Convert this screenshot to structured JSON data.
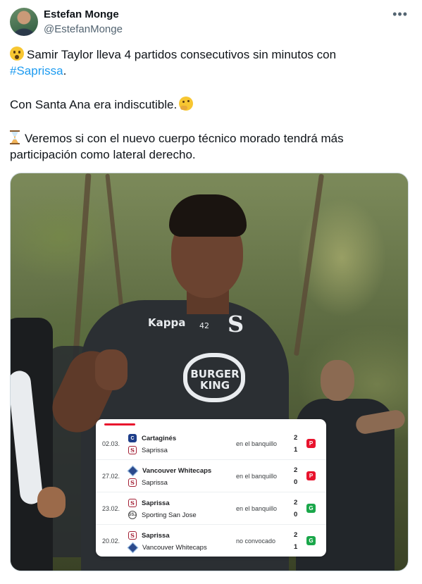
{
  "author": {
    "name": "Estefan Monge",
    "handle": "@EstefanMonge",
    "more_icon": "more-horizontal-icon"
  },
  "tweet": {
    "line1_before": "Samir Taylor lleva 4 partidos consecutivos sin minutos con",
    "hashtag": "#Saprissa",
    "line1_after": ".",
    "line2": "Con Santa Ana era indiscutible.",
    "line3": "Veremos si con el nuevo cuerpo técnico morado tendrá más participación como lateral derecho.",
    "emojis": [
      "face-with-open-mouth",
      "thinking-face",
      "hourglass"
    ]
  },
  "media": {
    "jersey_brand": "Kappa",
    "jersey_number": "42",
    "club_mark": "S",
    "sponsor_line1": "BURGER",
    "sponsor_line2": "KING"
  },
  "matches": [
    {
      "date": "02.03.",
      "team_a": "Cartaginés",
      "crest_a": "C",
      "crest_a_type": "car",
      "team_b": "Saprissa",
      "crest_b": "S",
      "crest_b_type": "sap",
      "bold": "a",
      "status": "en el banquillo",
      "score_a": "2",
      "score_b": "1",
      "result": "P",
      "result_color": "#e8132d"
    },
    {
      "date": "27.02.",
      "team_a": "Vancouver Whitecaps",
      "crest_a": "",
      "crest_a_type": "van",
      "team_b": "Saprissa",
      "crest_b": "S",
      "crest_b_type": "sap",
      "bold": "a",
      "status": "en el banquillo",
      "score_a": "2",
      "score_b": "0",
      "result": "P",
      "result_color": "#e8132d"
    },
    {
      "date": "23.02.",
      "team_a": "Saprissa",
      "crest_a": "S",
      "crest_a_type": "sap",
      "team_b": "Sporting San Jose",
      "crest_b": "SSJ",
      "crest_b_type": "ssj",
      "bold": "a",
      "status": "en el banquillo",
      "score_a": "2",
      "score_b": "0",
      "result": "G",
      "result_color": "#1aa74a"
    },
    {
      "date": "20.02.",
      "team_a": "Saprissa",
      "crest_a": "S",
      "crest_a_type": "sap",
      "team_b": "Vancouver Whitecaps",
      "crest_b": "",
      "crest_b_type": "van",
      "bold": "a",
      "status": "no convocado",
      "score_a": "2",
      "score_b": "1",
      "result": "G",
      "result_color": "#1aa74a"
    }
  ]
}
